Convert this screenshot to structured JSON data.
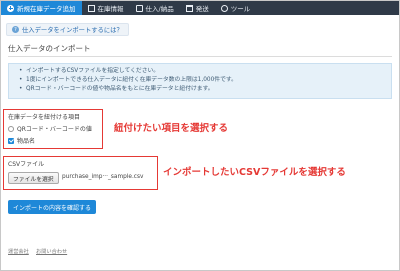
{
  "nav": {
    "items": [
      {
        "label": "新規在庫データ追加",
        "icon": "plus-circle-icon",
        "active": true
      },
      {
        "label": "在庫情報",
        "icon": "grid-icon",
        "active": false
      },
      {
        "label": "仕入/納品",
        "icon": "truck-icon",
        "active": false
      },
      {
        "label": "発送",
        "icon": "box-icon",
        "active": false
      },
      {
        "label": "ツール",
        "icon": "tool-icon",
        "active": false
      }
    ]
  },
  "help": {
    "label": "仕入データをインポートするには？",
    "icon": "question-icon"
  },
  "page": {
    "title": "仕入データのインポート"
  },
  "info": {
    "lines": [
      "インポートするCSVファイルを指定してください。",
      "1度にインポートできる仕入データに紐付く在庫データ数の上限は1,000件です。",
      "QRコード・バーコードの値や物品名をもとに在庫データと紐付けます。"
    ]
  },
  "link_field": {
    "label": "在庫データを紐付ける項目",
    "option_qr": "QRコード・バーコードの値",
    "option_name": "物品名",
    "name_checked": true
  },
  "annotations": {
    "select_link": "紐付けたい項目を選択する",
    "select_csv": "インポートしたいCSVファイルを選択する",
    "color": "#e53935"
  },
  "csv": {
    "label": "CSVファイル",
    "choose_button": "ファイルを選択",
    "file_name": "purchase_imp···_sample.csv"
  },
  "actions": {
    "confirm": "インポートの内容を確認する"
  },
  "footer": {
    "terms": "運営会社",
    "contact": "お問い合わせ"
  },
  "colors": {
    "accent": "#1e88d8",
    "nav_bg": "#2f3a48",
    "info_bg": "#e6f1f9",
    "annotation": "#e53935"
  }
}
